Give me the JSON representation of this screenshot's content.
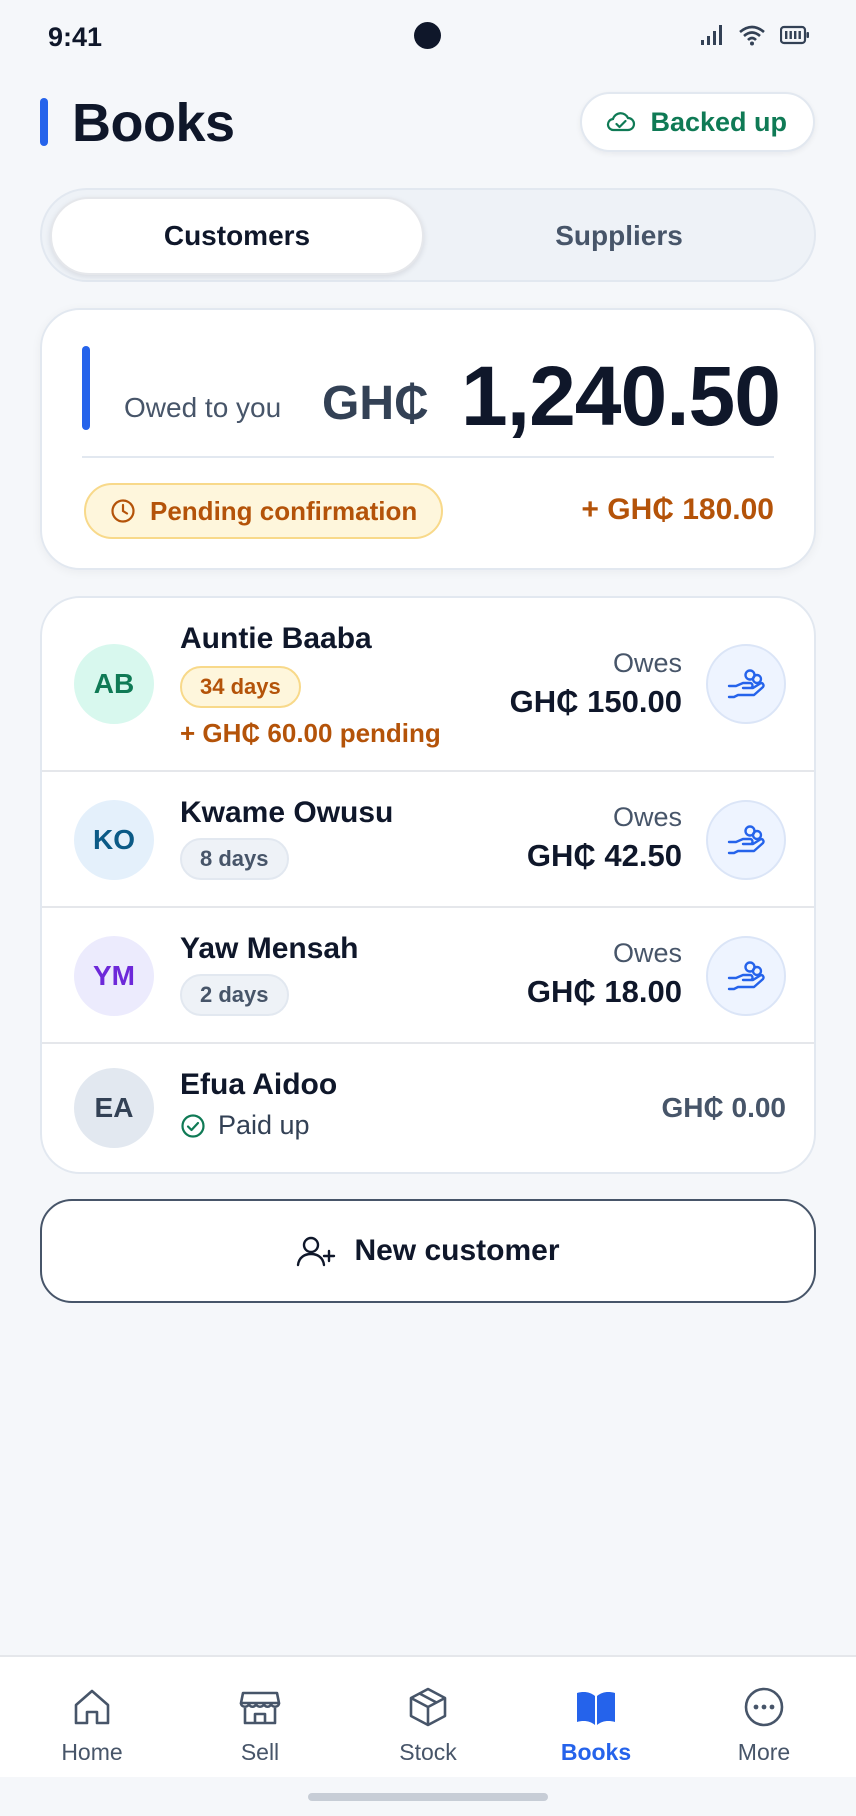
{
  "status_bar": {
    "time": "9:41"
  },
  "header": {
    "title": "Books",
    "backup_label": "Backed up"
  },
  "tabs": [
    {
      "label": "Customers",
      "active": true
    },
    {
      "label": "Suppliers",
      "active": false
    }
  ],
  "summary": {
    "label": "Owed to you",
    "currency": "GH₵",
    "amount": "1,240.50",
    "pending_label": "Pending confirmation",
    "pending_amount": "+ GH₵ 180.00"
  },
  "customers": [
    {
      "initials": "AB",
      "name": "Auntie Baaba",
      "days": "34 days",
      "pending": "+ GH₵ 60.00 pending",
      "status": "Owes",
      "amount": "GH₵ 150.00",
      "avatar_bg": "#d8f8ee",
      "avatar_fg": "#0f7a55"
    },
    {
      "initials": "KO",
      "name": "Kwame Owusu",
      "days": "8 days",
      "status": "Owes",
      "amount": "GH₵ 42.50",
      "avatar_bg": "#e4f0fb",
      "avatar_fg": "#0b5a86"
    },
    {
      "initials": "YM",
      "name": "Yaw Mensah",
      "days": "2 days",
      "status": "Owes",
      "amount": "GH₵ 18.00",
      "avatar_bg": "#ecebfd",
      "avatar_fg": "#6d28d9"
    },
    {
      "initials": "EA",
      "name": "Efua Aidoo",
      "paid_label": "Paid up",
      "amount": "GH₵ 0.00",
      "avatar_bg": "#e2e8f0",
      "avatar_fg": "#334155"
    }
  ],
  "actions": {
    "new_customer_label": "New customer"
  },
  "bottom_nav": [
    {
      "label": "Home",
      "icon": "home-icon"
    },
    {
      "label": "Sell",
      "icon": "store-icon"
    },
    {
      "label": "Stock",
      "icon": "box-icon"
    },
    {
      "label": "Books",
      "icon": "book-icon",
      "active": true
    },
    {
      "label": "More",
      "icon": "more-icon"
    }
  ],
  "colors": {
    "accent": "#2563eb",
    "pending": "#b45309",
    "success": "#0f7a55"
  }
}
